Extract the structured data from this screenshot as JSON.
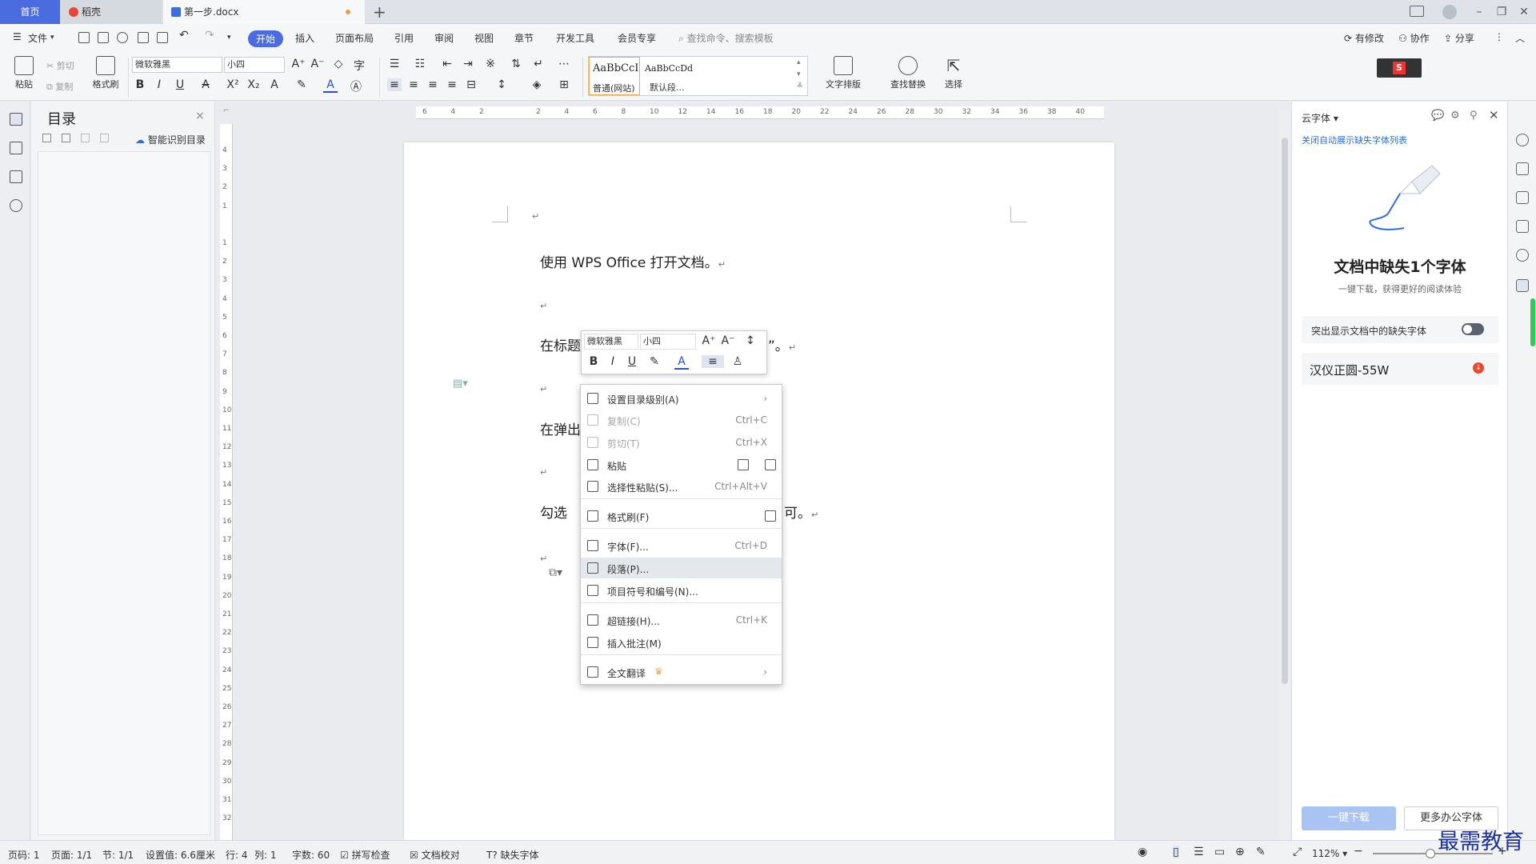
{
  "tabs": {
    "home": "首页",
    "daoke": "稻壳",
    "doc": "第一步.docx"
  },
  "menu": {
    "file": "文件",
    "items": [
      "开始",
      "插入",
      "页面布局",
      "引用",
      "审阅",
      "视图",
      "章节",
      "开发工具",
      "会员专享"
    ],
    "search_placeholder": "查找命令、搜索模板",
    "right": [
      "有修改",
      "协作",
      "分享"
    ]
  },
  "ribbon": {
    "paste": "粘贴",
    "cut": "剪切",
    "copy": "复制",
    "format_painter": "格式刷",
    "font_name": "微软雅黑",
    "font_size": "小四",
    "style1_preview": "AaBbCcI",
    "style1_name": "普通(网站)",
    "style2_preview": "AaBbCcDd",
    "style2_name": "默认段...",
    "text_layout": "文字排版",
    "find_replace": "查找替换",
    "select": "选择"
  },
  "toc": {
    "title": "目录",
    "smart": "智能识别目录"
  },
  "ruler_h": [
    "6",
    "4",
    "2",
    "",
    "2",
    "4",
    "6",
    "8",
    "10",
    "12",
    "14",
    "16",
    "18",
    "20",
    "22",
    "24",
    "26",
    "28",
    "30",
    "32",
    "34",
    "36",
    "38",
    "40"
  ],
  "ruler_v": [
    "4",
    "3",
    "2",
    "1",
    "",
    "1",
    "2",
    "3",
    "4",
    "5",
    "6",
    "7",
    "8",
    "9",
    "10",
    "11",
    "12",
    "13",
    "14",
    "15",
    "16",
    "17",
    "18",
    "19",
    "20",
    "21",
    "22",
    "23",
    "24",
    "25",
    "26",
    "27",
    "28",
    "29",
    "30",
    "31",
    "32"
  ],
  "document": {
    "line1": "使用 WPS Office 打开文档。",
    "line2_left": "在标题",
    "line2_right": "”。",
    "line3_left": "在弹出",
    "line4_left": "勾选",
    "line4_right": "可。",
    "para_mark": "↵"
  },
  "mini_toolbar": {
    "font": "微软雅黑",
    "size": "小四"
  },
  "context_menu": [
    {
      "label": "设置目录级别(A)",
      "shortcut": "›",
      "disabled": false
    },
    {
      "label": "复制(C)",
      "shortcut": "Ctrl+C",
      "disabled": true
    },
    {
      "label": "剪切(T)",
      "shortcut": "Ctrl+X",
      "disabled": true
    },
    {
      "label": "粘贴",
      "shortcut": "",
      "disabled": false
    },
    {
      "label": "选择性粘贴(S)...",
      "shortcut": "Ctrl+Alt+V",
      "disabled": false
    },
    {
      "label": "格式刷(F)",
      "shortcut": "",
      "disabled": false
    },
    {
      "label": "字体(F)...",
      "shortcut": "Ctrl+D",
      "disabled": false
    },
    {
      "label": "段落(P)...",
      "shortcut": "",
      "disabled": false
    },
    {
      "label": "项目符号和编号(N)...",
      "shortcut": "",
      "disabled": false
    },
    {
      "label": "超链接(H)...",
      "shortcut": "Ctrl+K",
      "disabled": false
    },
    {
      "label": "插入批注(M)",
      "shortcut": "",
      "disabled": false
    },
    {
      "label": "全文翻译",
      "shortcut": "›",
      "disabled": false
    }
  ],
  "right_panel": {
    "title": "云字体",
    "link": "关闭自动展示缺失字体列表",
    "heading": "文档中缺失1个字体",
    "subheading": "一键下载，获得更好的阅读体验",
    "toggle_label": "突出显示文档中的缺失字体",
    "font_item": "汉仪正圆-55W",
    "btn_download": "一键下载",
    "btn_more": "更多办公字体"
  },
  "status": {
    "page_code": "页码: 1",
    "page": "页面: 1/1",
    "section": "节: 1/1",
    "setting": "设置值: 6.6厘米",
    "row": "行: 4",
    "col": "列: 1",
    "words": "字数: 60",
    "spell": "拼写检查",
    "proof": "文档校对",
    "missing_font": "缺失字体",
    "zoom": "112%"
  },
  "watermark": "最需教育",
  "colors": {
    "accent": "#4a6cde",
    "tab_dot": "#f29b38",
    "link": "#2d6ee0",
    "wm": "#1a2fa8"
  }
}
